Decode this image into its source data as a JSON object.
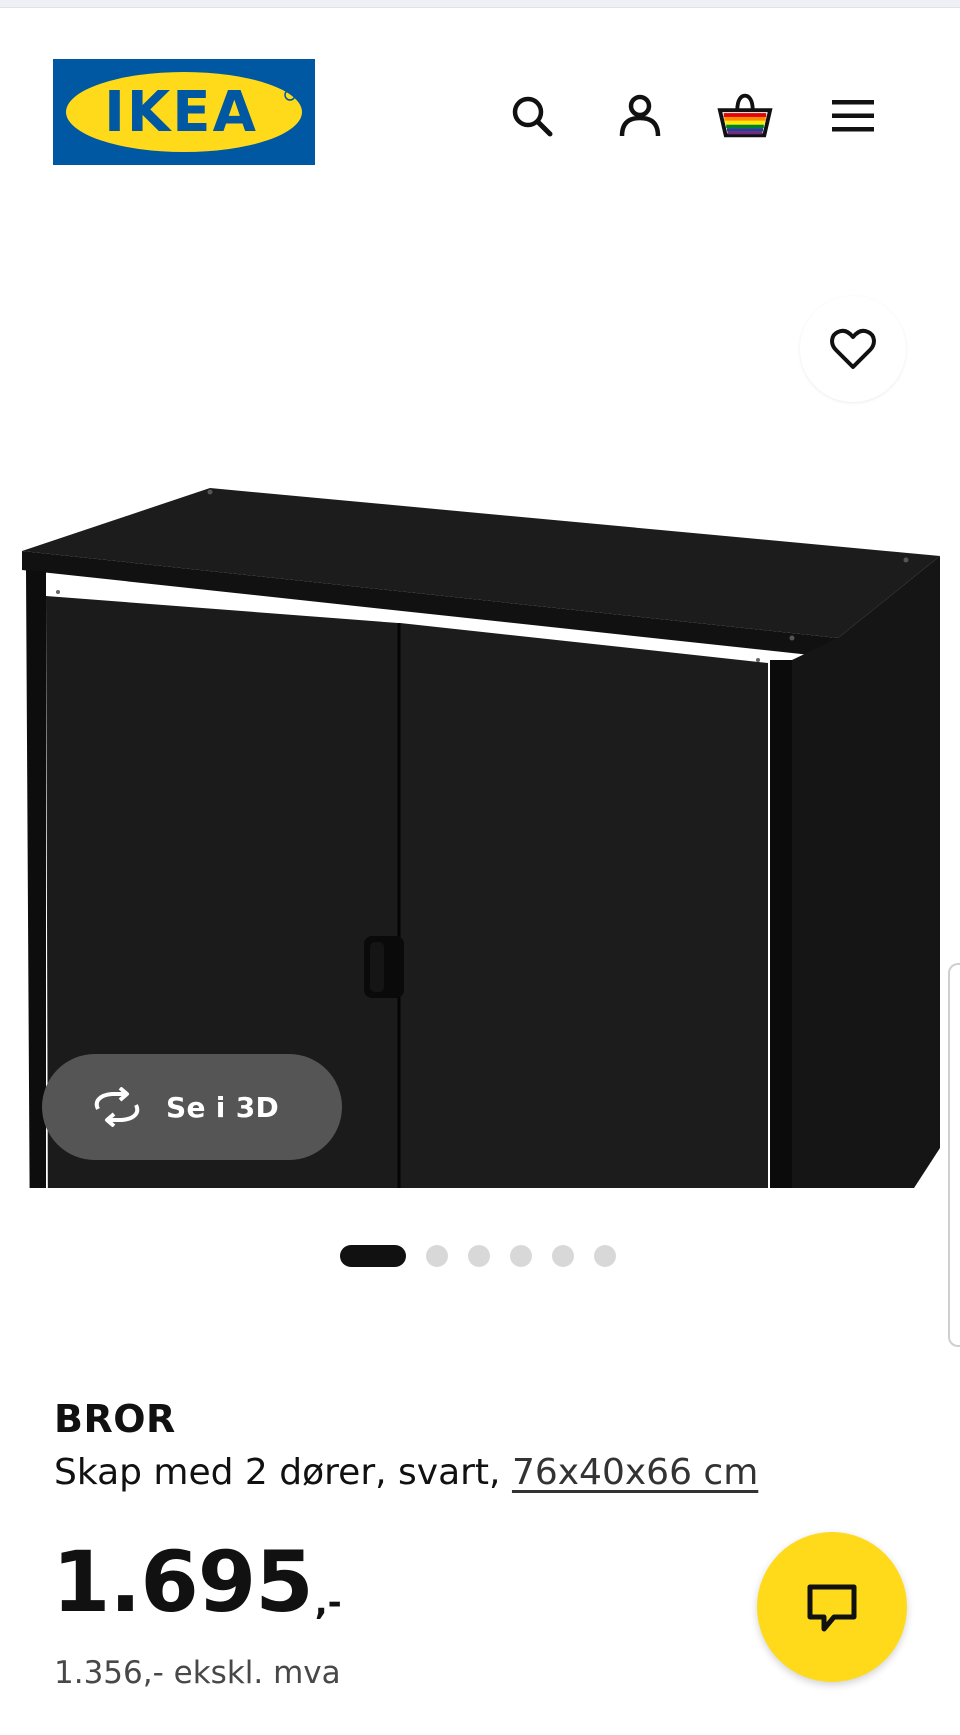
{
  "header": {
    "logo_text": "IKEA",
    "logo_colors": {
      "background": "#0058a3",
      "ellipse": "#ffda1a",
      "text": "#0058a3"
    },
    "icons": [
      "search-icon",
      "user-icon",
      "shopping-bag-icon",
      "menu-icon"
    ]
  },
  "gallery": {
    "view_3d_label": "Se i 3D",
    "view_3d_icon": "rotate-3d-icon",
    "favourite_icon": "heart-icon",
    "slide_count": 6,
    "active_slide": 1
  },
  "product": {
    "name": "BROR",
    "description": "Skap med 2 dører, svart, ",
    "dimensions": "76x40x66 cm",
    "price": "1.695",
    "price_suffix": ",-",
    "price_ex_vat": "1.356,- ekskl. mva"
  },
  "chat": {
    "icon": "chat-bubble-icon",
    "color": "#ffda1a"
  }
}
